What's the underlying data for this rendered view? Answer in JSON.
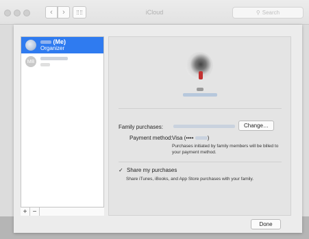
{
  "window": {
    "title": "iCloud",
    "search_placeholder": "Search"
  },
  "members": [
    {
      "name": "(Me)",
      "role": "Organizer",
      "initials": "",
      "selected": true
    },
    {
      "name": "",
      "role": "",
      "initials": "MB",
      "selected": false
    }
  ],
  "detail": {
    "family_purchases_label": "Family purchases:",
    "change_label": "Change…",
    "payment_method_label": "Payment method:",
    "payment_method_value": "Visa (••••",
    "payment_method_close": ")",
    "payment_note": "Purchases initiated by family members will be billed to your payment method.",
    "share_label": "Share my purchases",
    "share_checked": true,
    "share_desc": "Share iTunes, iBooks, and App Store purchases with your family."
  },
  "list_controls": {
    "add": "+",
    "remove": "−"
  },
  "footer": {
    "done_label": "Done"
  },
  "colors": {
    "selection": "#2f7bf0"
  }
}
